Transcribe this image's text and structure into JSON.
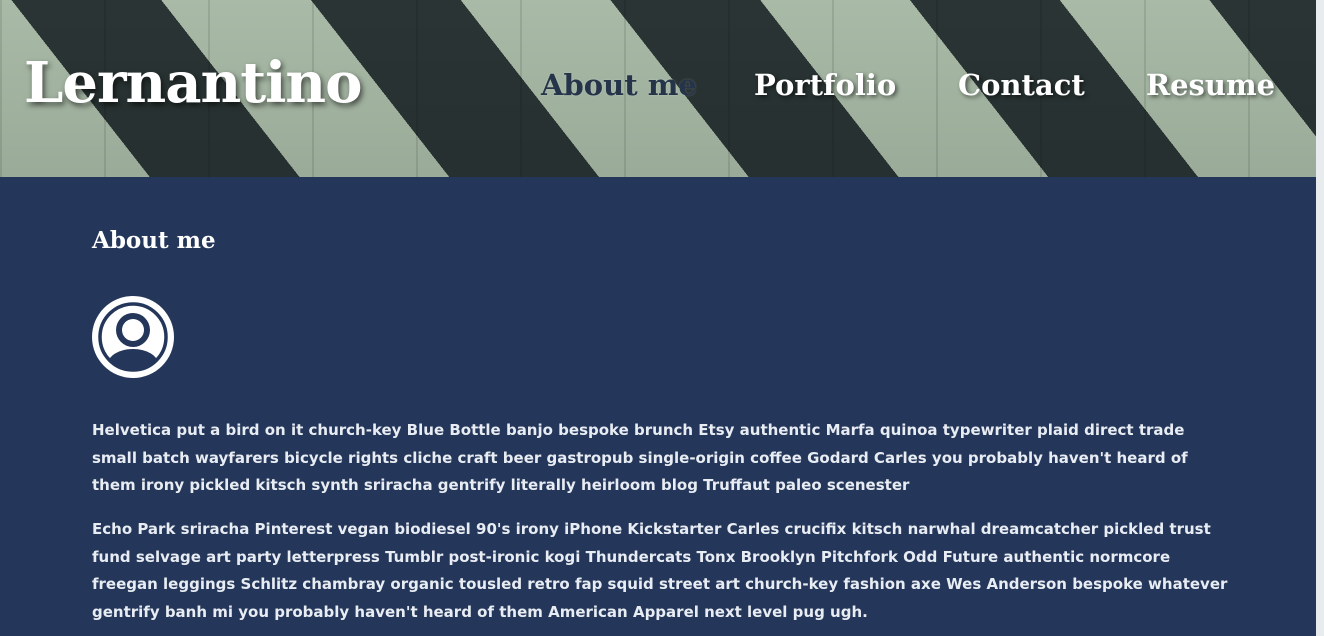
{
  "site": {
    "logo_text": "Lernantino"
  },
  "nav": {
    "items": [
      {
        "label": "About me"
      },
      {
        "label": "Portfolio"
      },
      {
        "label": "Contact"
      },
      {
        "label": "Resume"
      }
    ]
  },
  "about": {
    "heading": "About me",
    "avatar_icon": "user-avatar-icon",
    "paragraphs": [
      "Helvetica put a bird on it church-key Blue Bottle banjo bespoke brunch Etsy authentic Marfa quinoa typewriter plaid direct trade small batch wayfarers bicycle rights cliche craft beer gastropub single-origin coffee Godard Carles you probably haven't heard of them irony pickled kitsch synth sriracha gentrify literally heirloom blog Truffaut paleo scenester",
      "Echo Park sriracha Pinterest vegan biodiesel 90's irony iPhone Kickstarter Carles crucifix kitsch narwhal dreamcatcher pickled trust fund selvage art party letterpress Tumblr post-ironic kogi Thundercats Tonx Brooklyn Pitchfork Odd Future authentic normcore freegan leggings Schlitz chambray organic tousled retro fap squid street art church-key fashion axe Wes Anderson bespoke whatever gentrify banh mi you probably haven't heard of them American Apparel next level pug ugh."
    ]
  },
  "colors": {
    "header_stripe_light": "#bcd0ba",
    "header_stripe_dark": "#2f3a3a",
    "main_background": "#243659",
    "nav_active": "#26344a",
    "text": "#ffffff"
  }
}
